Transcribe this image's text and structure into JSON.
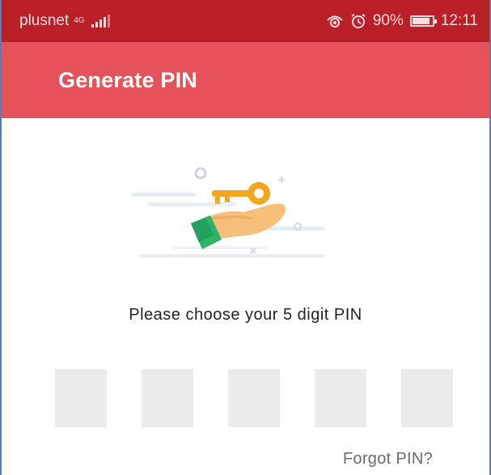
{
  "status_bar": {
    "carrier": "plusnet",
    "network": "4G",
    "battery": "90%",
    "battery_level": 0.9,
    "time": "12:11",
    "icons": [
      "signal-icon",
      "eye-icon",
      "alarm-icon",
      "battery-icon"
    ]
  },
  "app_bar": {
    "title": "Generate PIN"
  },
  "main": {
    "illustration": "hand-key-icon",
    "prompt": "Please choose your 5 digit PIN",
    "pin_digits": [
      "",
      "",
      "",
      "",
      ""
    ],
    "forgot_label": "Forgot PIN?"
  },
  "colors": {
    "status_bar": "#b81f27",
    "app_bar": "#e5525a",
    "pin_box": "#ececec"
  }
}
